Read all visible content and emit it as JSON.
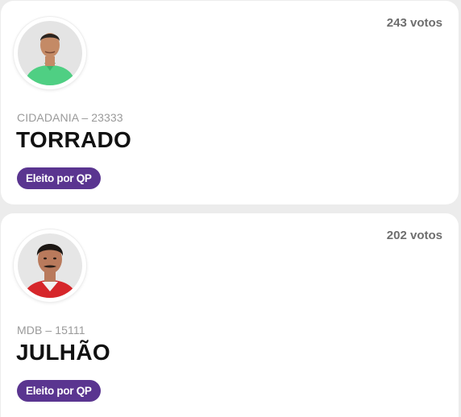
{
  "candidates": [
    {
      "votes": "243 votos",
      "party": "CIDADANIA – 23333",
      "name": "TORRADO",
      "badge": "Eleito por QP",
      "colors": {
        "shirt": "#4fcf83",
        "skin": "#c48a66",
        "hair": "#2a2420",
        "bg": "#e4e4e4"
      }
    },
    {
      "votes": "202 votos",
      "party": "MDB – 15111",
      "name": "JULHÃO",
      "badge": "Eleito por QP",
      "colors": {
        "shirt": "#d6262a",
        "skin": "#b97a5c",
        "hair": "#1c1714",
        "bg": "#e6e6e6"
      }
    }
  ],
  "accent": "#5a3590"
}
